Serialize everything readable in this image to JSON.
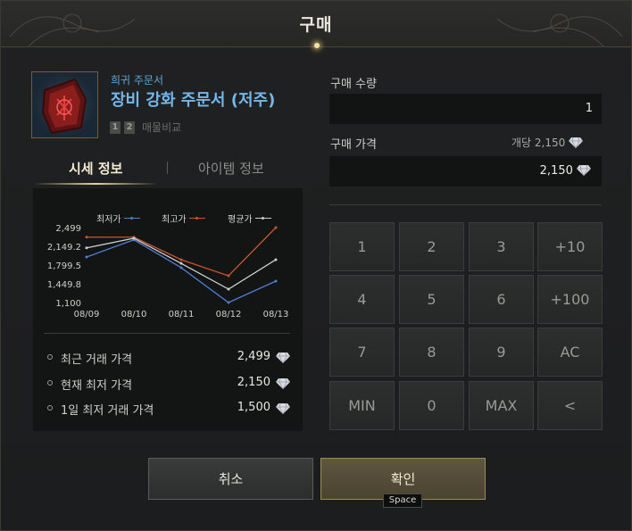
{
  "dialog": {
    "title": "구매"
  },
  "item": {
    "grade": "희귀 주문서",
    "name": "장비 강화 주문서 (저주)",
    "compare_keys": [
      "1",
      "2"
    ],
    "compare_label": "매물비교"
  },
  "tabs": {
    "market": "시세 정보",
    "item": "아이템 정보"
  },
  "legend": {
    "min": "최저가",
    "max": "최고가",
    "avg": "평균가"
  },
  "colors": {
    "min": "#4f7fd0",
    "max": "#c9552f",
    "avg": "#cfcfcf",
    "accent": "#e8d49a"
  },
  "chart_data": {
    "type": "line",
    "x": [
      "08/09",
      "08/10",
      "08/11",
      "08/12",
      "08/13"
    ],
    "yticks": [
      "2,499",
      "2,149.2",
      "1,799.5",
      "1,449.8",
      "1,100"
    ],
    "ylim": [
      1100,
      2499
    ],
    "series": [
      {
        "name": "최저가",
        "color": "#4f7fd0",
        "values": [
          1950,
          2270,
          1750,
          1100,
          1500
        ]
      },
      {
        "name": "최고가",
        "color": "#c9552f",
        "values": [
          2320,
          2320,
          1900,
          1600,
          2499
        ]
      },
      {
        "name": "평균가",
        "color": "#cfcfcf",
        "values": [
          2120,
          2300,
          1830,
          1350,
          1900
        ]
      }
    ]
  },
  "stats": [
    {
      "label": "최근 거래 가격",
      "value": "2,499"
    },
    {
      "label": "현재 최저 가격",
      "value": "2,150"
    },
    {
      "label": "1일 최저 거래 가격",
      "value": "1,500"
    }
  ],
  "purchase": {
    "quantity_label": "구매 수량",
    "quantity": "1",
    "price_label": "구매 가격",
    "unit_price": "개당 2,150",
    "total": "2,150"
  },
  "keypad": [
    "1",
    "2",
    "3",
    "+10",
    "4",
    "5",
    "6",
    "+100",
    "7",
    "8",
    "9",
    "AC",
    "MIN",
    "0",
    "MAX",
    "<"
  ],
  "buttons": {
    "cancel": "취소",
    "confirm": "확인",
    "confirm_shortcut": "Space"
  },
  "icons": {
    "currency": "diamond-icon",
    "item": "cursed-scroll-icon"
  }
}
